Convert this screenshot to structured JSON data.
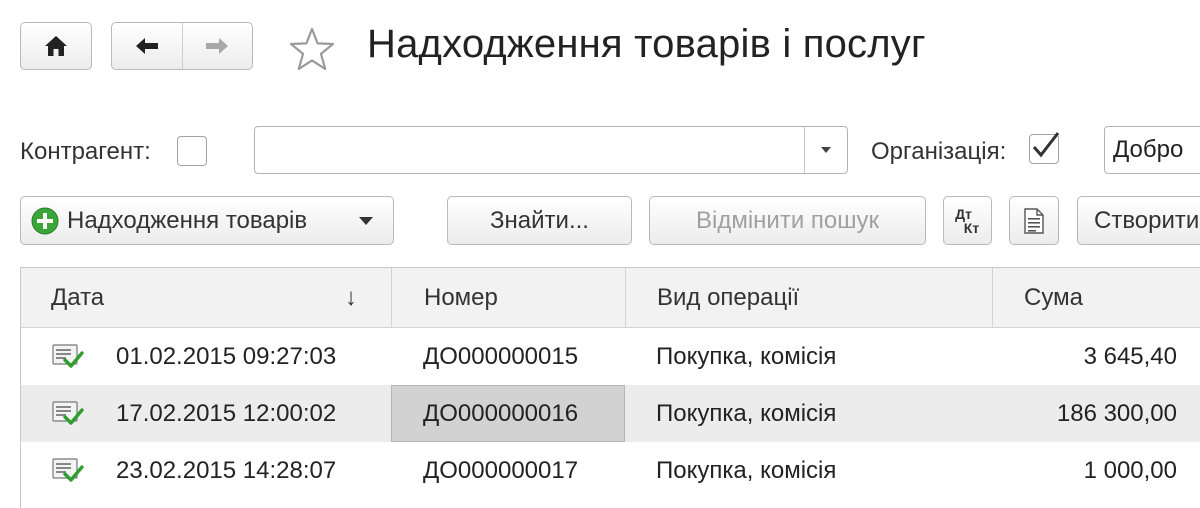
{
  "nav": {
    "home": "home-icon",
    "back": "arrow-left-icon",
    "forward": "arrow-right-icon",
    "favorite": "star-icon"
  },
  "window": {
    "title": "Надходження товарів і послуг"
  },
  "filters": {
    "counterparty_label": "Контрагент:",
    "counterparty_checked": false,
    "counterparty_value": "",
    "organization_label": "Організація:",
    "organization_checked": true,
    "organization_value": "Добро"
  },
  "toolbar": {
    "create_menu_label": "Надходження товарів",
    "find_label": "Знайти...",
    "cancel_search_label": "Відмінити пошук",
    "dt_label": "Дт",
    "kt_label": "Кт",
    "create_label": "Створити"
  },
  "table": {
    "columns": [
      "Дата",
      "Номер",
      "Вид операції",
      "Сума"
    ],
    "sort_indicator": "↓",
    "rows": [
      {
        "date": "01.02.2015 09:27:03",
        "number": "ДО000000015",
        "operation": "Покупка, комісія",
        "amount": "3 645,40"
      },
      {
        "date": "17.02.2015 12:00:02",
        "number": "ДО000000016",
        "operation": "Покупка, комісія",
        "amount": "186 300,00"
      },
      {
        "date": "23.02.2015 14:28:07",
        "number": "ДО000000017",
        "operation": "Покупка, комісія",
        "amount": "1 000,00"
      }
    ]
  },
  "colors": {
    "accent_green": "#3aa63a",
    "check_green": "#2f9e2f",
    "selection": "#ececec"
  }
}
